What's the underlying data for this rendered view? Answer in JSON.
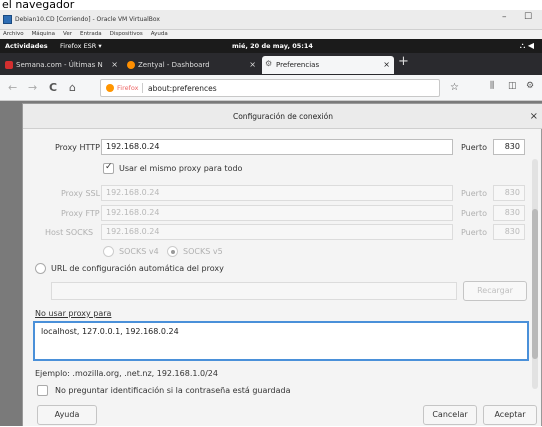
{
  "top_caption": "el navegador",
  "vbox": {
    "title": "Debian10.CD [Corriendo] - Oracle VM VirtualBox",
    "menu": [
      "Archivo",
      "Máquina",
      "Ver",
      "Entrada",
      "Dispositivos",
      "Ayuda"
    ],
    "minimize": "–",
    "maximize": "☐"
  },
  "gnome": {
    "activities": "Actividades",
    "app": "Firefox ESR ▾",
    "clock": "mié, 20 de may, 05:14",
    "tray": "⛬ ◀"
  },
  "tabs": [
    {
      "label": "Semana.com - Últimas N",
      "color": "#d32f2f"
    },
    {
      "label": "Zentyal - Dashboard",
      "color": "#ff8f00"
    },
    {
      "label": "Preferencias",
      "color": "#666666"
    }
  ],
  "tab_close": "×",
  "new_tab": "+",
  "nav": {
    "back": "←",
    "forward": "→",
    "reload": "C",
    "home": "⌂",
    "identity": "Firefox",
    "url": "about:preferences",
    "bookmark": "☆",
    "library": "⫼",
    "sidebar": "◫",
    "extra": "⚙"
  },
  "dialog": {
    "title": "Configuración de conexión",
    "close": "×",
    "proxy_http_label": "Proxy HTTP",
    "proxy_http_value": "192.168.0.24",
    "port_label": "Puerto",
    "port_http_value": "830",
    "use_same_proxy": "Usar el mismo proxy para todo",
    "proxy_ssl_label": "Proxy SSL",
    "proxy_ssl_value": "192.168.0.24",
    "port_ssl_value": "830",
    "proxy_ftp_label": "Proxy FTP",
    "proxy_ftp_value": "192.168.0.24",
    "port_ftp_value": "830",
    "host_socks_label": "Host SOCKS",
    "host_socks_value": "192.168.0.24",
    "port_socks_value": "830",
    "socks_v4": "SOCKS v4",
    "socks_v5": "SOCKS v5",
    "auto_config_label": "URL de configuración automática del proxy",
    "auto_config_value": "",
    "reload_button": "Recargar",
    "no_proxy_label": "No usar proxy para",
    "no_proxy_value": "localhost, 127.0.0.1, 192.168.0.24",
    "example_text": "Ejemplo: .mozilla.org, .net.nz, 192.168.1.0/24",
    "no_prompt_auth": "No preguntar identificación si la contraseña está guardada",
    "help_button": "Ayuda",
    "cancel_button": "Cancelar",
    "accept_button": "Aceptar"
  }
}
